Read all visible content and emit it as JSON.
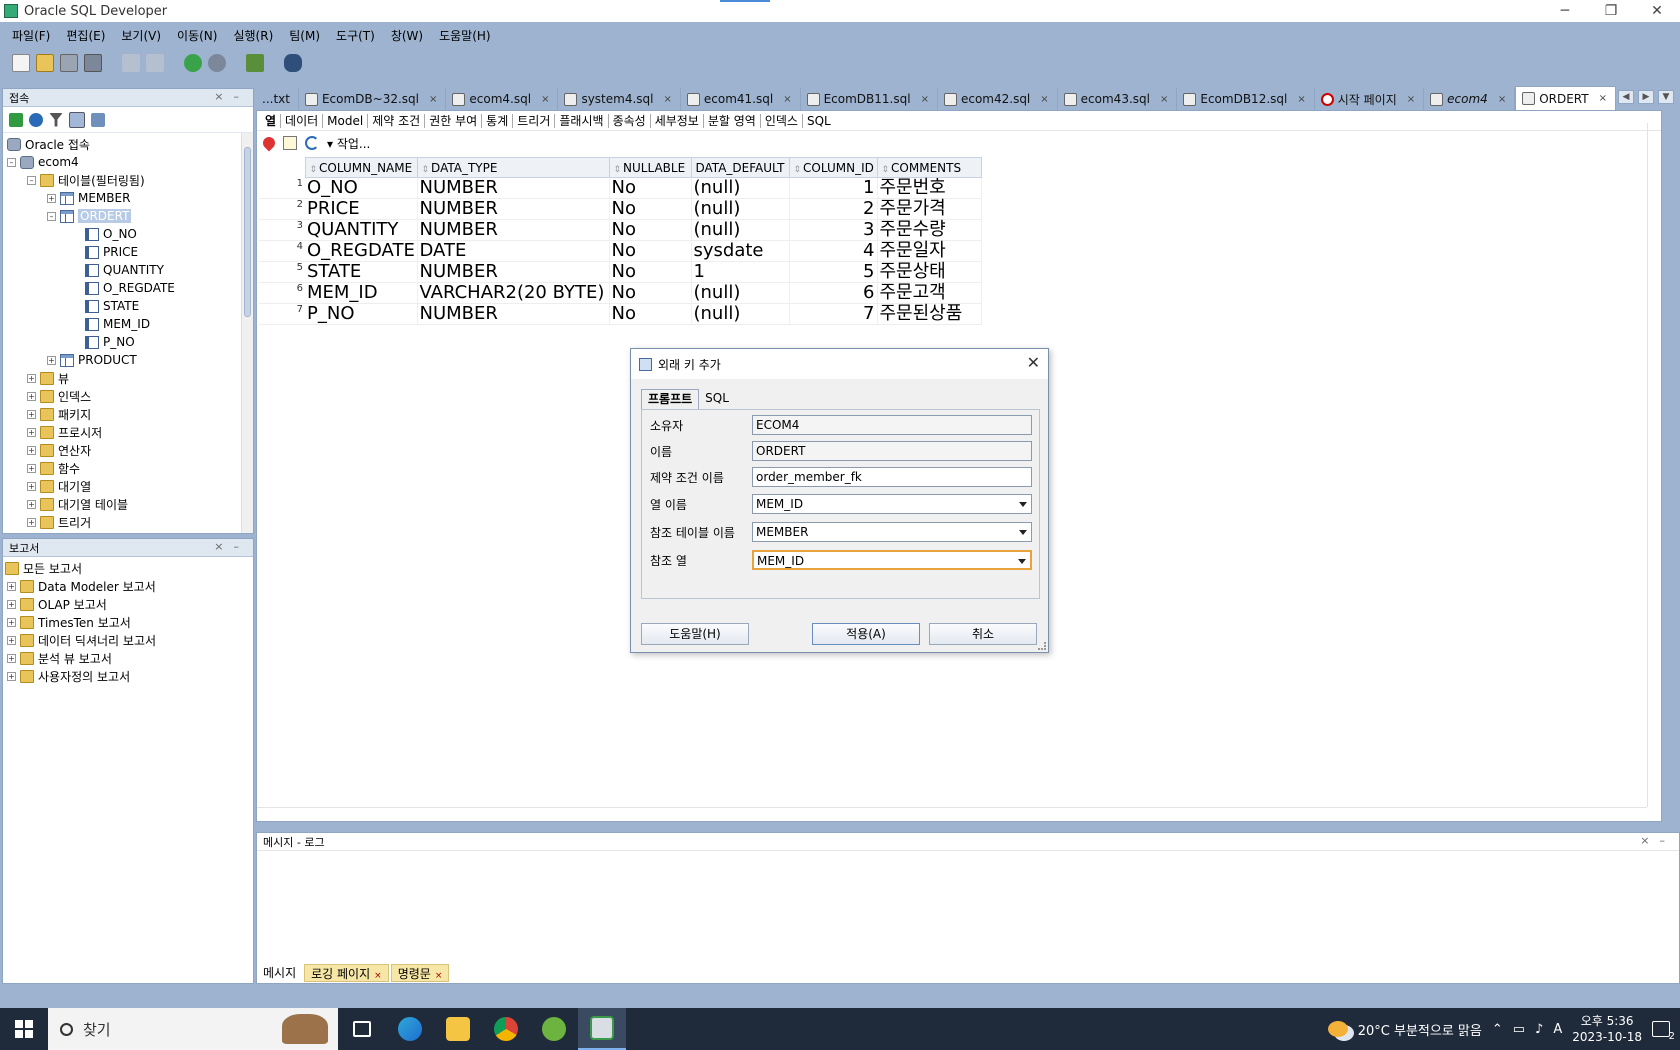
{
  "window": {
    "title": "Oracle SQL Developer",
    "minimize": "─",
    "maximize": "❐",
    "close": "✕"
  },
  "menu": [
    "파일(F)",
    "편집(E)",
    "보기(V)",
    "이동(N)",
    "실행(R)",
    "팀(M)",
    "도구(T)",
    "창(W)",
    "도움말(H)"
  ],
  "connections": {
    "title": "접속",
    "root": "Oracle 접속",
    "conn": "ecom4",
    "tables_node": "테이블(필터링됨)",
    "member": "MEMBER",
    "ordert": "ORDERT",
    "columns": [
      "O_NO",
      "PRICE",
      "QUANTITY",
      "O_REGDATE",
      "STATE",
      "MEM_ID",
      "P_NO"
    ],
    "product": "PRODUCT",
    "others": [
      "뷰",
      "인덱스",
      "패키지",
      "프로시저",
      "연산자",
      "함수",
      "대기열",
      "대기열 테이블",
      "트리거"
    ]
  },
  "reports": {
    "title": "보고서",
    "root": "모든 보고서",
    "items": [
      "Data Modeler 보고서",
      "OLAP 보고서",
      "TimesTen 보고서",
      "데이터 딕셔너리 보고서",
      "분석 뷰 보고서",
      "사용자정의 보고서"
    ]
  },
  "tabs": [
    {
      "label": "...txt",
      "italic": false
    },
    {
      "label": "EcomDB~32.sql",
      "italic": false
    },
    {
      "label": "ecom4.sql",
      "italic": false
    },
    {
      "label": "system4.sql",
      "italic": false
    },
    {
      "label": "ecom41.sql",
      "italic": false
    },
    {
      "label": "EcomDB11.sql",
      "italic": false
    },
    {
      "label": "ecom42.sql",
      "italic": false
    },
    {
      "label": "ecom43.sql",
      "italic": false
    },
    {
      "label": "EcomDB12.sql",
      "italic": false
    },
    {
      "label": "시작 페이지",
      "italic": false
    },
    {
      "label": "ecom4",
      "italic": true
    },
    {
      "label": "ORDERT",
      "italic": false
    }
  ],
  "subtabs": [
    "열",
    "데이터",
    "Model",
    "제약 조건",
    "권한 부여",
    "통계",
    "트리거",
    "플래시백",
    "종속성",
    "세부정보",
    "분할 영역",
    "인덱스",
    "SQL"
  ],
  "edit_toolbar": {
    "actions_label": "작업..."
  },
  "grid": {
    "headers": [
      "COLUMN_NAME",
      "DATA_TYPE",
      "NULLABLE",
      "DATA_DEFAULT",
      "COLUMN_ID",
      "COMMENTS"
    ],
    "rows": [
      [
        "1",
        "O_NO",
        "NUMBER",
        "No",
        "(null)",
        "1",
        "주문번호"
      ],
      [
        "2",
        "PRICE",
        "NUMBER",
        "No",
        "(null)",
        "2",
        "주문가격"
      ],
      [
        "3",
        "QUANTITY",
        "NUMBER",
        "No",
        "(null)",
        "3",
        "주문수량"
      ],
      [
        "4",
        "O_REGDATE",
        "DATE",
        "No",
        "sysdate",
        "4",
        "주문일자"
      ],
      [
        "5",
        "STATE",
        "NUMBER",
        "No",
        "1",
        "5",
        "주문상태"
      ],
      [
        "6",
        "MEM_ID",
        "VARCHAR2(20 BYTE)",
        "No",
        "(null)",
        "6",
        "주문고객"
      ],
      [
        "7",
        "P_NO",
        "NUMBER",
        "No",
        "(null)",
        "7",
        "주문된상품"
      ]
    ]
  },
  "log": {
    "title": "메시지 - 로그",
    "tabs": [
      "메시지",
      "로깅 페이지",
      "명령문"
    ]
  },
  "dialog": {
    "title": "외래 키 추가",
    "close": "✕",
    "tabs": [
      "프롬프트",
      "SQL"
    ],
    "fields": {
      "owner_label": "소유자",
      "owner_value": "ECOM4",
      "name_label": "이름",
      "name_value": "ORDERT",
      "constraint_label": "제약 조건 이름",
      "constraint_value": "order_member_fk",
      "column_label": "열 이름",
      "column_value": "MEM_ID",
      "ref_table_label": "참조 테이블 이름",
      "ref_table_value": "MEMBER",
      "ref_column_label": "참조 열",
      "ref_column_value": "MEM_ID"
    },
    "buttons": {
      "help": "도움말(H)",
      "apply": "적용(A)",
      "cancel": "취소"
    }
  },
  "taskbar": {
    "search_placeholder": "찾기",
    "weather": "20°C  부분적으로 맑음",
    "time": "오후 5:36",
    "date": "2023-10-18",
    "ime": "A",
    "notifications": "2"
  }
}
